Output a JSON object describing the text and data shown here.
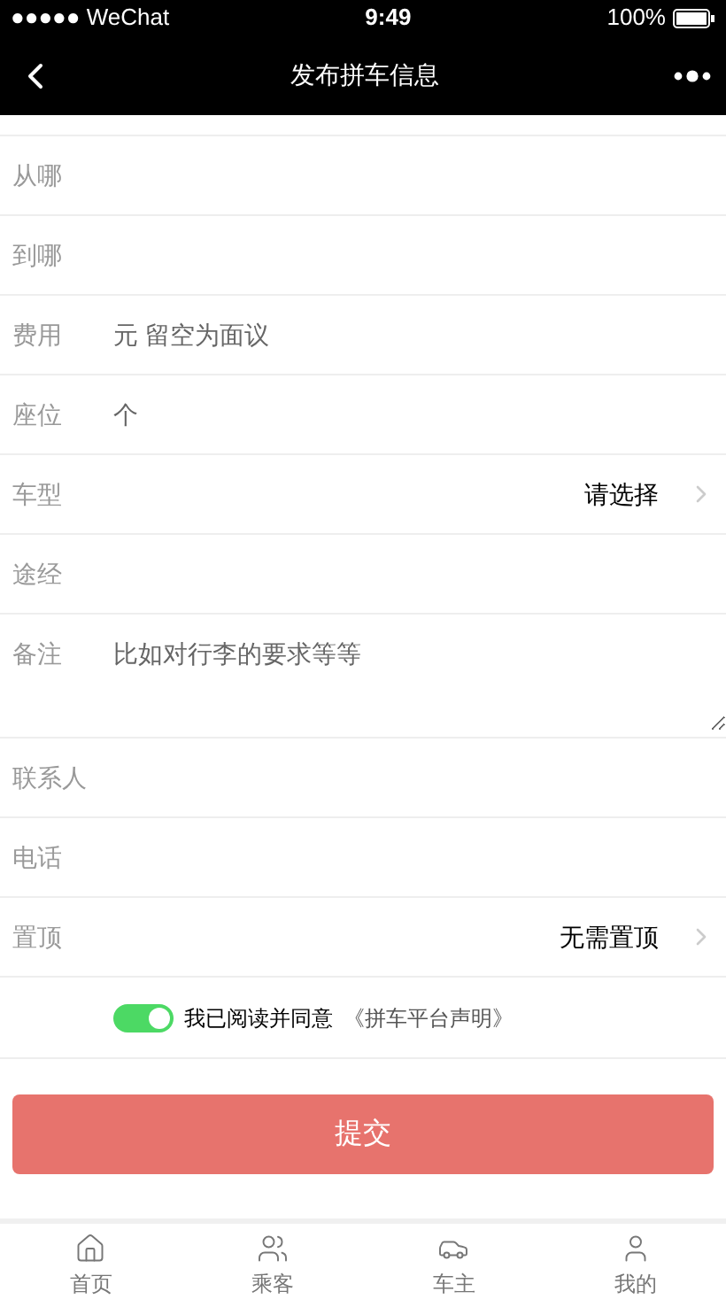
{
  "status_bar": {
    "carrier": "●●●●● WeChat",
    "time": "9:49",
    "battery": "100%"
  },
  "nav": {
    "title": "发布拼车信息"
  },
  "form": [
    {
      "kind": "input",
      "label": "从哪"
    },
    {
      "kind": "input",
      "label": "到哪"
    },
    {
      "kind": "input",
      "label": "费用",
      "placeholder": "元 留空为面议"
    },
    {
      "kind": "input",
      "label": "座位",
      "placeholder": "个"
    },
    {
      "kind": "select",
      "label": "车型",
      "value": "请选择"
    },
    {
      "kind": "input",
      "label": "途经"
    },
    {
      "kind": "textarea",
      "label": "备注",
      "placeholder": "比如对行李的要求等等"
    },
    {
      "kind": "input",
      "label": "联系人"
    },
    {
      "kind": "input",
      "label": "电话"
    },
    {
      "kind": "select",
      "label": "置顶",
      "value": "无需置顶"
    }
  ],
  "agreement": {
    "on": true,
    "text": "我已阅读并同意",
    "link": "《拼车平台声明》"
  },
  "submit": "提交",
  "tabs": [
    {
      "label": "首页",
      "selected": false
    },
    {
      "label": "乘客",
      "selected": false
    },
    {
      "label": "车主",
      "selected": false
    },
    {
      "label": "我的",
      "selected": false
    }
  ]
}
